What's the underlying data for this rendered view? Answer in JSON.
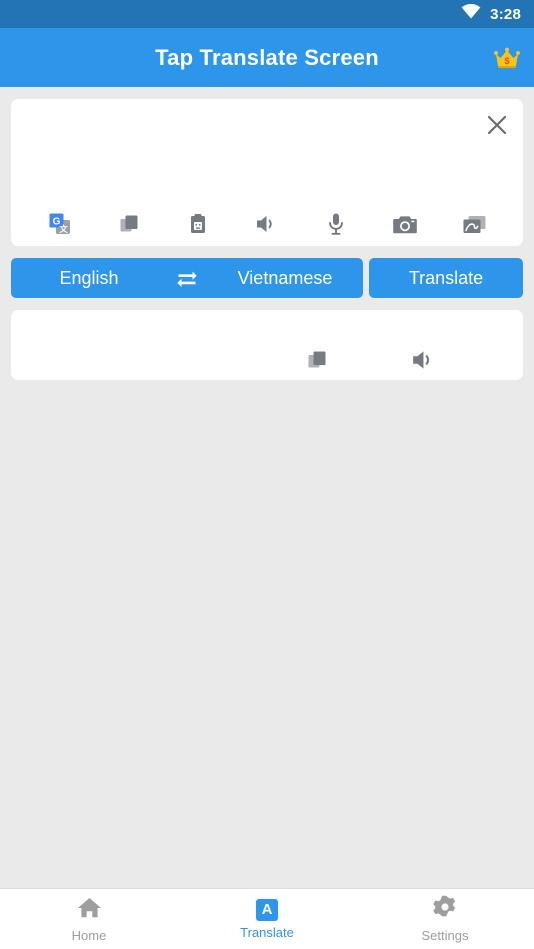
{
  "status_bar": {
    "time": "3:28",
    "wifi_icon": "wifi-icon"
  },
  "app_bar": {
    "title": "Tap Translate Screen",
    "premium_icon": "crown-icon"
  },
  "input_card": {
    "text": "",
    "close_icon": "close-icon",
    "tools": [
      {
        "name": "google-translate-icon",
        "label": "Google Translate"
      },
      {
        "name": "copy-icon",
        "label": "Copy"
      },
      {
        "name": "paste-icon",
        "label": "Paste"
      },
      {
        "name": "speaker-icon",
        "label": "Speak"
      },
      {
        "name": "microphone-icon",
        "label": "Voice input"
      },
      {
        "name": "camera-icon",
        "label": "Camera"
      },
      {
        "name": "image-icon",
        "label": "Gallery"
      }
    ]
  },
  "language_bar": {
    "source_language": "English",
    "target_language": "Vietnamese",
    "swap_icon": "swap-icon",
    "translate_label": "Translate"
  },
  "output_card": {
    "text": "",
    "tools": [
      {
        "name": "copy-icon",
        "label": "Copy"
      },
      {
        "name": "speaker-icon",
        "label": "Speak"
      }
    ]
  },
  "bottom_nav": {
    "items": [
      {
        "label": "Home",
        "icon": "home-icon",
        "active": false
      },
      {
        "label": "Translate",
        "icon": "translate-a-icon",
        "active": true
      },
      {
        "label": "Settings",
        "icon": "gear-icon",
        "active": false
      }
    ]
  },
  "colors": {
    "status_bar": "#2274b5",
    "app_bar": "#2d95ea",
    "accent": "#2d95ea",
    "page_background": "#eaeaea",
    "card_background": "#ffffff",
    "icon_gray": "#767b82",
    "inactive_nav": "#9e9e9e"
  }
}
